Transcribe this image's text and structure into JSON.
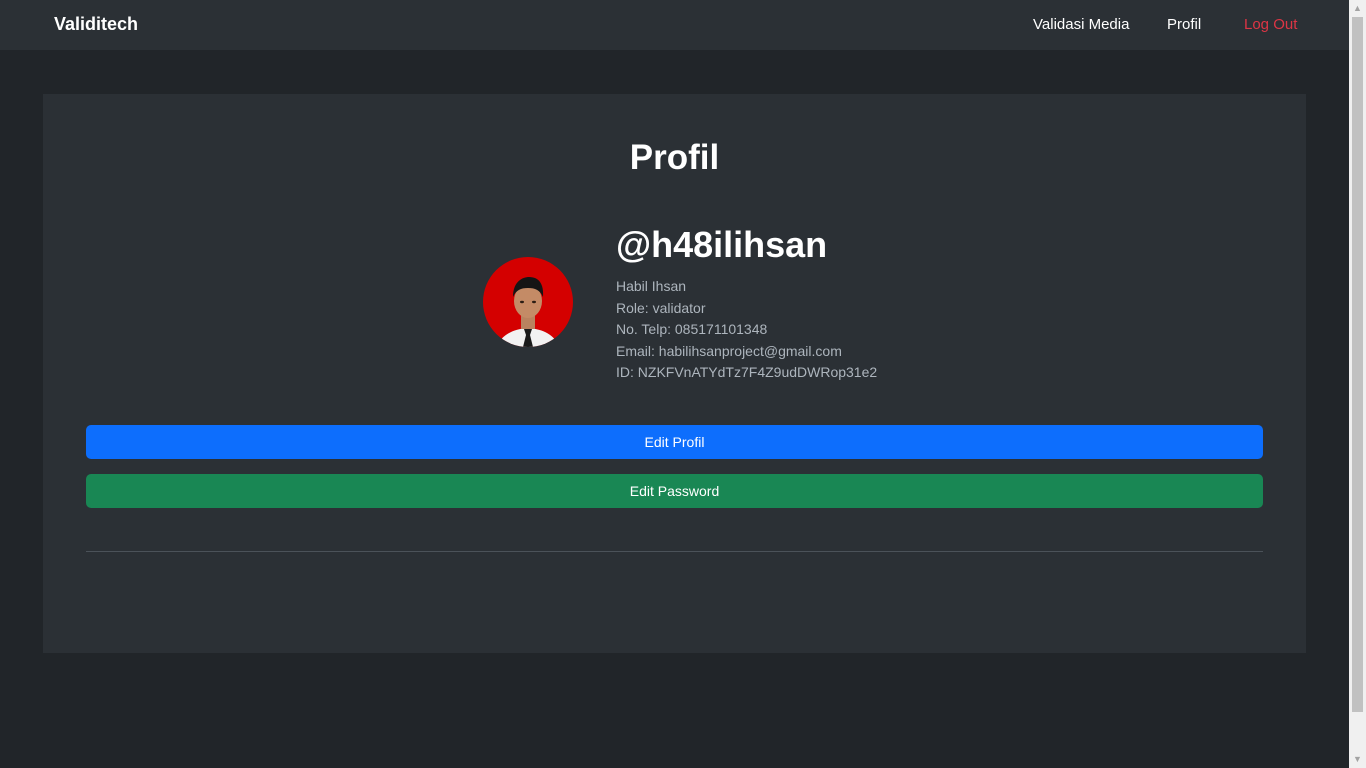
{
  "navbar": {
    "brand": "Validitech",
    "links": [
      "Validasi Media",
      "Profil",
      "Log Out"
    ]
  },
  "profile": {
    "title": "Profil",
    "username": "@h48ilihsan",
    "name": "Habil Ihsan",
    "role": "Role: validator",
    "phone": "No. Telp: 085171101348",
    "email": "Email: habilihsanproject@gmail.com",
    "id": "ID: NZKFVnATYdTz7F4Z9udDWRop31e2"
  },
  "buttons": {
    "edit_profile": "Edit Profil",
    "edit_password": "Edit Password"
  },
  "colors": {
    "primary": "#0d6efd",
    "success": "#198754",
    "danger": "#dc3545",
    "avatar_bg": "#d40000"
  }
}
